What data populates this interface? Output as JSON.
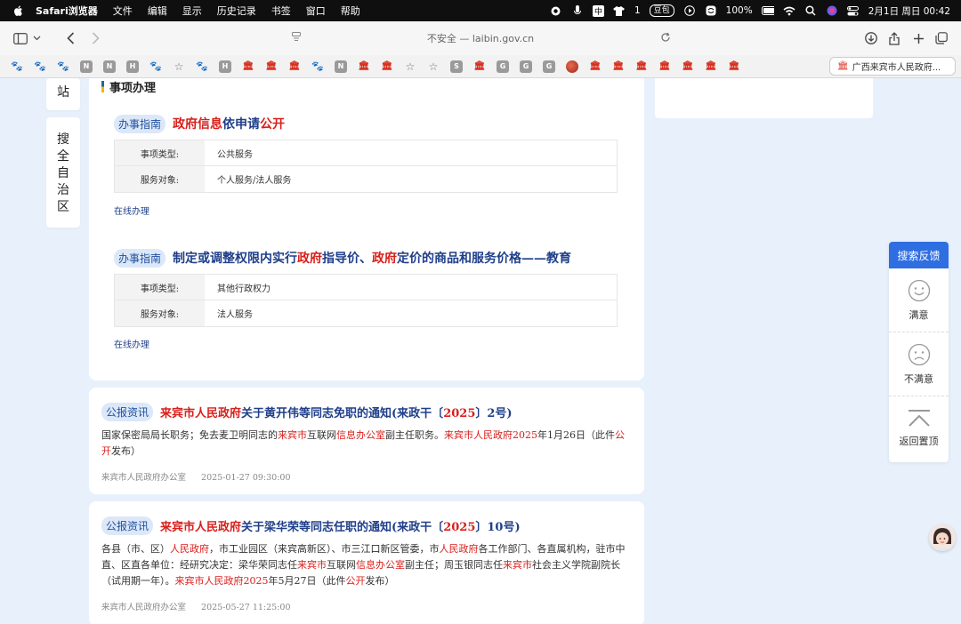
{
  "menubar": {
    "app": "Safari浏览器",
    "items": [
      "文件",
      "编辑",
      "显示",
      "历史记录",
      "书签",
      "窗口",
      "帮助"
    ],
    "input_method": "中",
    "badge_one": "1",
    "pill": "豆包",
    "battery": "100%",
    "datetime": "2月1日 周日  00:42"
  },
  "toolbar": {
    "url": "不安全 — laibin.gov.cn"
  },
  "favorites": {
    "icons": [
      "paw",
      "paw",
      "paw",
      "N",
      "N",
      "H",
      "paw",
      "star",
      "paw",
      "H",
      "emblem",
      "emblem",
      "emblem",
      "paw",
      "N",
      "emblem",
      "emblem",
      "star",
      "star",
      "S",
      "emblem",
      "G",
      "G",
      "G",
      "ball",
      "emblem",
      "emblem",
      "emblem",
      "emblem",
      "emblem",
      "emblem",
      "emblem"
    ],
    "active_tab": "广西来宾市人民政府..."
  },
  "sidebar": {
    "top_char": "站",
    "search_chars": [
      "搜",
      "全",
      "自",
      "治",
      "区"
    ]
  },
  "section": {
    "title": "事项办理"
  },
  "guides": [
    {
      "tag": "办事指南",
      "title_parts": [
        {
          "t": "政府信息",
          "hl": true
        },
        {
          "t": "依申请",
          "hl": false
        },
        {
          "t": "公开",
          "hl": true
        }
      ],
      "rows": [
        {
          "k": "事项类型:",
          "v": "公共服务"
        },
        {
          "k": "服务对象:",
          "v": "个人服务/法人服务"
        }
      ],
      "online": "在线办理"
    },
    {
      "tag": "办事指南",
      "title_parts": [
        {
          "t": "制定或调整权限内实行",
          "hl": false
        },
        {
          "t": "政府",
          "hl": true
        },
        {
          "t": "指导价、",
          "hl": false
        },
        {
          "t": "政府",
          "hl": true
        },
        {
          "t": "定价的商品和服务价格——教育",
          "hl": false
        }
      ],
      "rows": [
        {
          "k": "事项类型:",
          "v": "其他行政权力"
        },
        {
          "k": "服务对象:",
          "v": "法人服务"
        }
      ],
      "online": "在线办理"
    }
  ],
  "news": [
    {
      "tag": "公报资讯",
      "title_parts": [
        {
          "t": "来宾市人民政府",
          "hl": true
        },
        {
          "t": "关于黄开伟等同志免职的通知(来政干〔",
          "hl": false
        },
        {
          "t": "2025",
          "hl": true
        },
        {
          "t": "〕2号)",
          "hl": false
        }
      ],
      "body_parts": [
        {
          "t": "国家保密局局长职务；免去麦卫明同志的",
          "hl": false
        },
        {
          "t": "来宾市",
          "hl": true
        },
        {
          "t": "互联网",
          "hl": false
        },
        {
          "t": "信息办公室",
          "hl": true
        },
        {
          "t": "副主任职务。",
          "hl": false
        },
        {
          "t": "来宾市人民政府2025",
          "hl": true
        },
        {
          "t": "年1月26日（此件",
          "hl": false
        },
        {
          "t": "公开",
          "hl": true
        },
        {
          "t": "发布）",
          "hl": false
        }
      ],
      "source": "来宾市人民政府办公室",
      "date": "2025-01-27 09:30:00"
    },
    {
      "tag": "公报资讯",
      "title_parts": [
        {
          "t": "来宾市人民政府",
          "hl": true
        },
        {
          "t": "关于梁华荣等同志任职的通知(来政干〔",
          "hl": false
        },
        {
          "t": "2025",
          "hl": true
        },
        {
          "t": "〕10号)",
          "hl": false
        }
      ],
      "body_parts": [
        {
          "t": "各县（市、区）",
          "hl": false
        },
        {
          "t": "人民政府",
          "hl": true
        },
        {
          "t": "，市工业园区（来宾高新区）、市三江口新区管委，市",
          "hl": false
        },
        {
          "t": "人民政府",
          "hl": true
        },
        {
          "t": "各工作部门、各直属机构，驻市中直、区直各单位：经研究决定：梁华荣同志任",
          "hl": false
        },
        {
          "t": "来宾市",
          "hl": true
        },
        {
          "t": "互联网",
          "hl": false
        },
        {
          "t": "信息办公室",
          "hl": true
        },
        {
          "t": "副主任；周玉银同志任",
          "hl": false
        },
        {
          "t": "来宾市",
          "hl": true
        },
        {
          "t": "社会主义学院副院长（试用期一年）。",
          "hl": false
        },
        {
          "t": "来宾市人民政府2025",
          "hl": true
        },
        {
          "t": "年5月27日（此件",
          "hl": false
        },
        {
          "t": "公开",
          "hl": true
        },
        {
          "t": "发布）",
          "hl": false
        }
      ],
      "source": "来宾市人民政府办公室",
      "date": "2025-05-27 11:25:00"
    }
  ],
  "feedback": {
    "title": "搜索反馈",
    "satisfied": "满意",
    "unsatisfied": "不满意",
    "back_top": "返回置顶"
  },
  "colors": {
    "accent_blue": "#1f3f8a",
    "highlight_red": "#d8201c",
    "feedback_blue": "#2f6ee0",
    "page_bg": "#e8f1fb"
  }
}
